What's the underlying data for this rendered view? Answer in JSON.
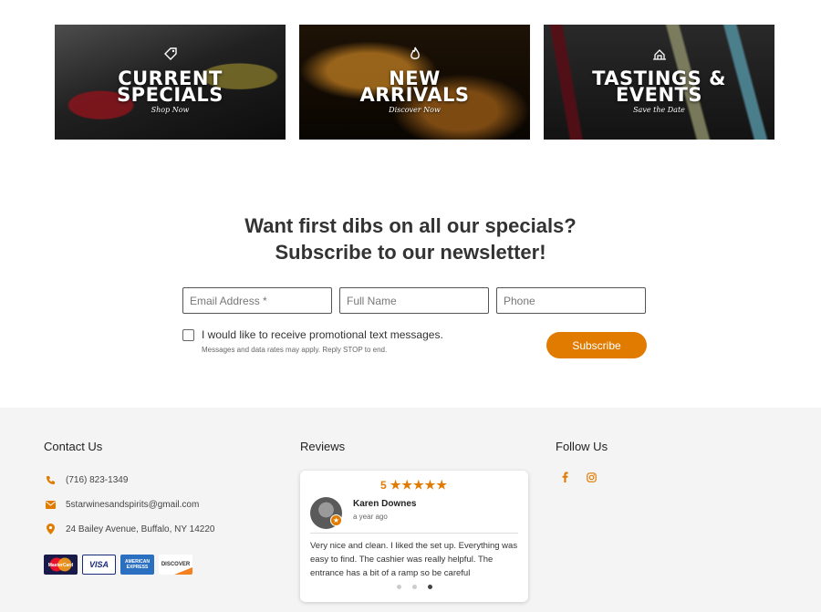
{
  "tiles": [
    {
      "title_line1": "CURRENT",
      "title_line2": "SPECIALS",
      "subtitle": "Shop Now",
      "icon": "tag-icon"
    },
    {
      "title_line1": "NEW",
      "title_line2": "ARRIVALS",
      "subtitle": "Discover Now",
      "icon": "flame-icon"
    },
    {
      "title_line1": "TASTINGS &",
      "title_line2": "EVENTS",
      "subtitle": "Save the Date",
      "icon": "wine-glasses-icon"
    }
  ],
  "newsletter": {
    "heading_line1": "Want first dibs on all our specials?",
    "heading_line2": "Subscribe to our newsletter!",
    "email_placeholder": "Email Address *",
    "name_placeholder": "Full Name",
    "phone_placeholder": "Phone",
    "optin_label": "I would like to receive promotional text messages.",
    "optin_note": "Messages and data rates may apply. Reply STOP to end.",
    "optin_checked": false,
    "subscribe_label": "Subscribe"
  },
  "footer": {
    "contact": {
      "title": "Contact Us",
      "phone": "(716) 823-1349",
      "email": "5starwinesandspirits@gmail.com",
      "address": "24 Bailey Avenue, Buffalo, NY 14220"
    },
    "payment_cards": {
      "mastercard": "MasterCard",
      "visa": "VISA",
      "amex_line1": "AMERICAN",
      "amex_line2": "EXPRESS",
      "discover": "DISCOVER"
    },
    "reviews": {
      "title": "Reviews",
      "rating": "5",
      "stars": "★★★★★",
      "reviewer": "Karen Downes",
      "time": "a year ago",
      "text": "Very nice and clean. I liked the set up. Everything was easy to find. The cashier was really helpful. The entrance has a bit of a ramp so be careful",
      "carousel_count": 3,
      "carousel_active": 3
    },
    "follow": {
      "title": "Follow Us",
      "icons": [
        "facebook-icon",
        "instagram-icon"
      ]
    }
  },
  "colors": {
    "accent": "#e07b00",
    "footer_bg": "#f4f4f4",
    "heading": "#333333"
  }
}
